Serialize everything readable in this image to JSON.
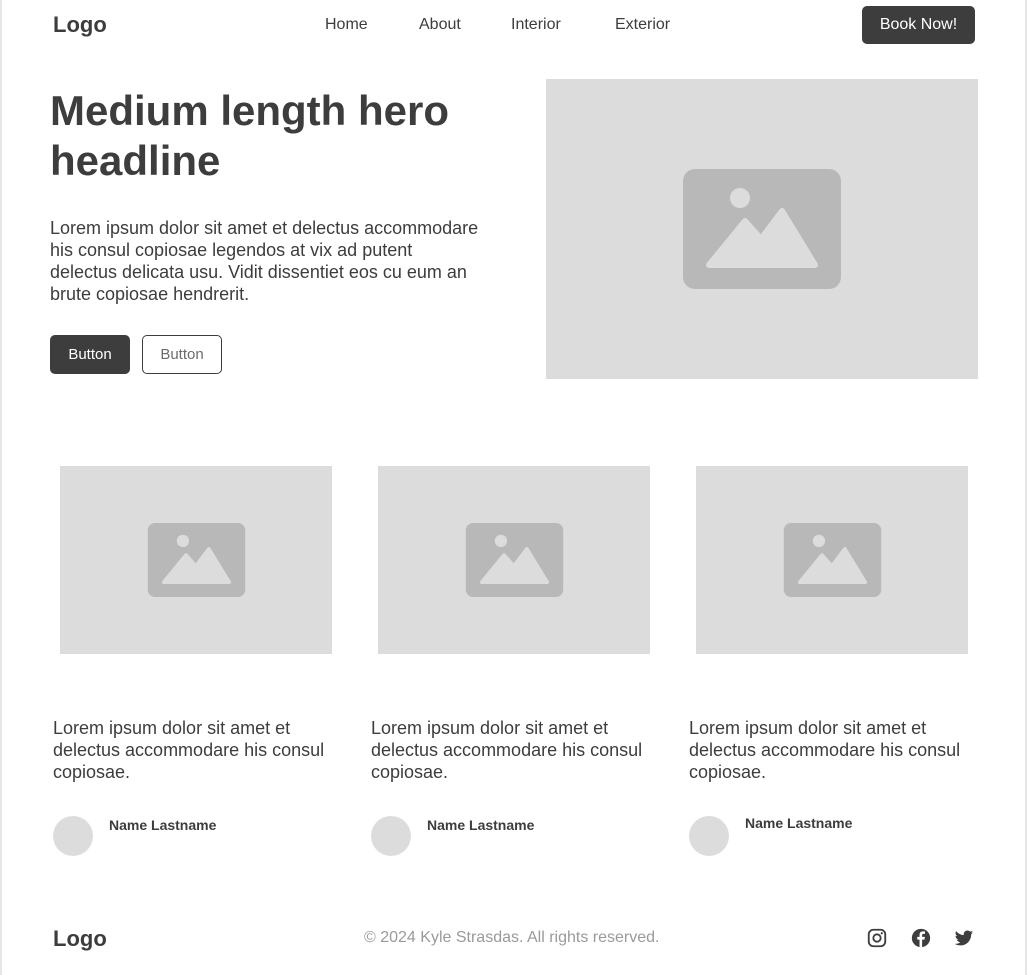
{
  "header": {
    "logo": "Logo",
    "nav": [
      "Home",
      "About",
      "Interior",
      "Exterior"
    ],
    "cta_label": "Book Now!"
  },
  "hero": {
    "headline": "Medium length hero headline",
    "body": "Lorem ipsum dolor sit amet et delectus accommodare his consul copiosae legendos at vix ad putent delectus delicata usu. Vidit dissentiet eos cu eum an brute copiosae hendrerit.",
    "primary_button": "Button",
    "secondary_button": "Button",
    "image_icon": "image-placeholder-icon"
  },
  "cards": [
    {
      "text": "Lorem ipsum dolor sit amet et delectus accommodare his consul copiosae.",
      "author": "Name Lastname"
    },
    {
      "text": "Lorem ipsum dolor sit amet et delectus accommodare his consul copiosae.",
      "author": "Name Lastname"
    },
    {
      "text": "Lorem ipsum dolor sit amet et delectus accommodare his consul copiosae.",
      "author": "Name Lastname"
    }
  ],
  "footer": {
    "logo": "Logo",
    "copyright": "© 2024 Kyle Strasdas. All rights reserved.",
    "social_icons": [
      "instagram-icon",
      "facebook-icon",
      "twitter-icon"
    ]
  },
  "colors": {
    "primary": "#3d3d3d",
    "placeholder_bg": "#dcdcdc",
    "placeholder_icon": "#b8b8b8",
    "muted_text": "#9a9a9a"
  }
}
